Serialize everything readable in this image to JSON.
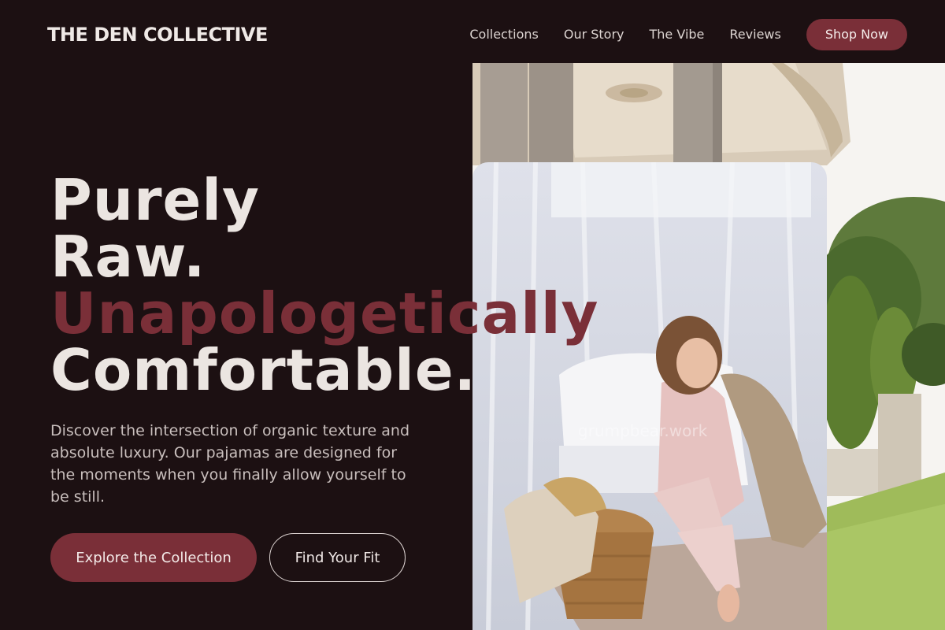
{
  "brand": "THE DEN COLLECTIVE",
  "nav": {
    "links": [
      "Collections",
      "Our Story",
      "The Vibe",
      "Reviews"
    ],
    "cta": "Shop Now"
  },
  "hero": {
    "title_lines": [
      "Purely",
      "Raw.",
      "Unapologetically",
      "Comfortable."
    ],
    "description": "Discover the intersection of organic texture and absolute luxury. Our pajamas are designed for the moments when you finally allow yourself to be still.",
    "primary_cta": "Explore the Collection",
    "secondary_cta": "Find Your Fit",
    "watermark": "grumpbear.work"
  },
  "colors": {
    "background": "#1c1012",
    "accent": "#7a2f38",
    "text": "#ebe5e1"
  }
}
